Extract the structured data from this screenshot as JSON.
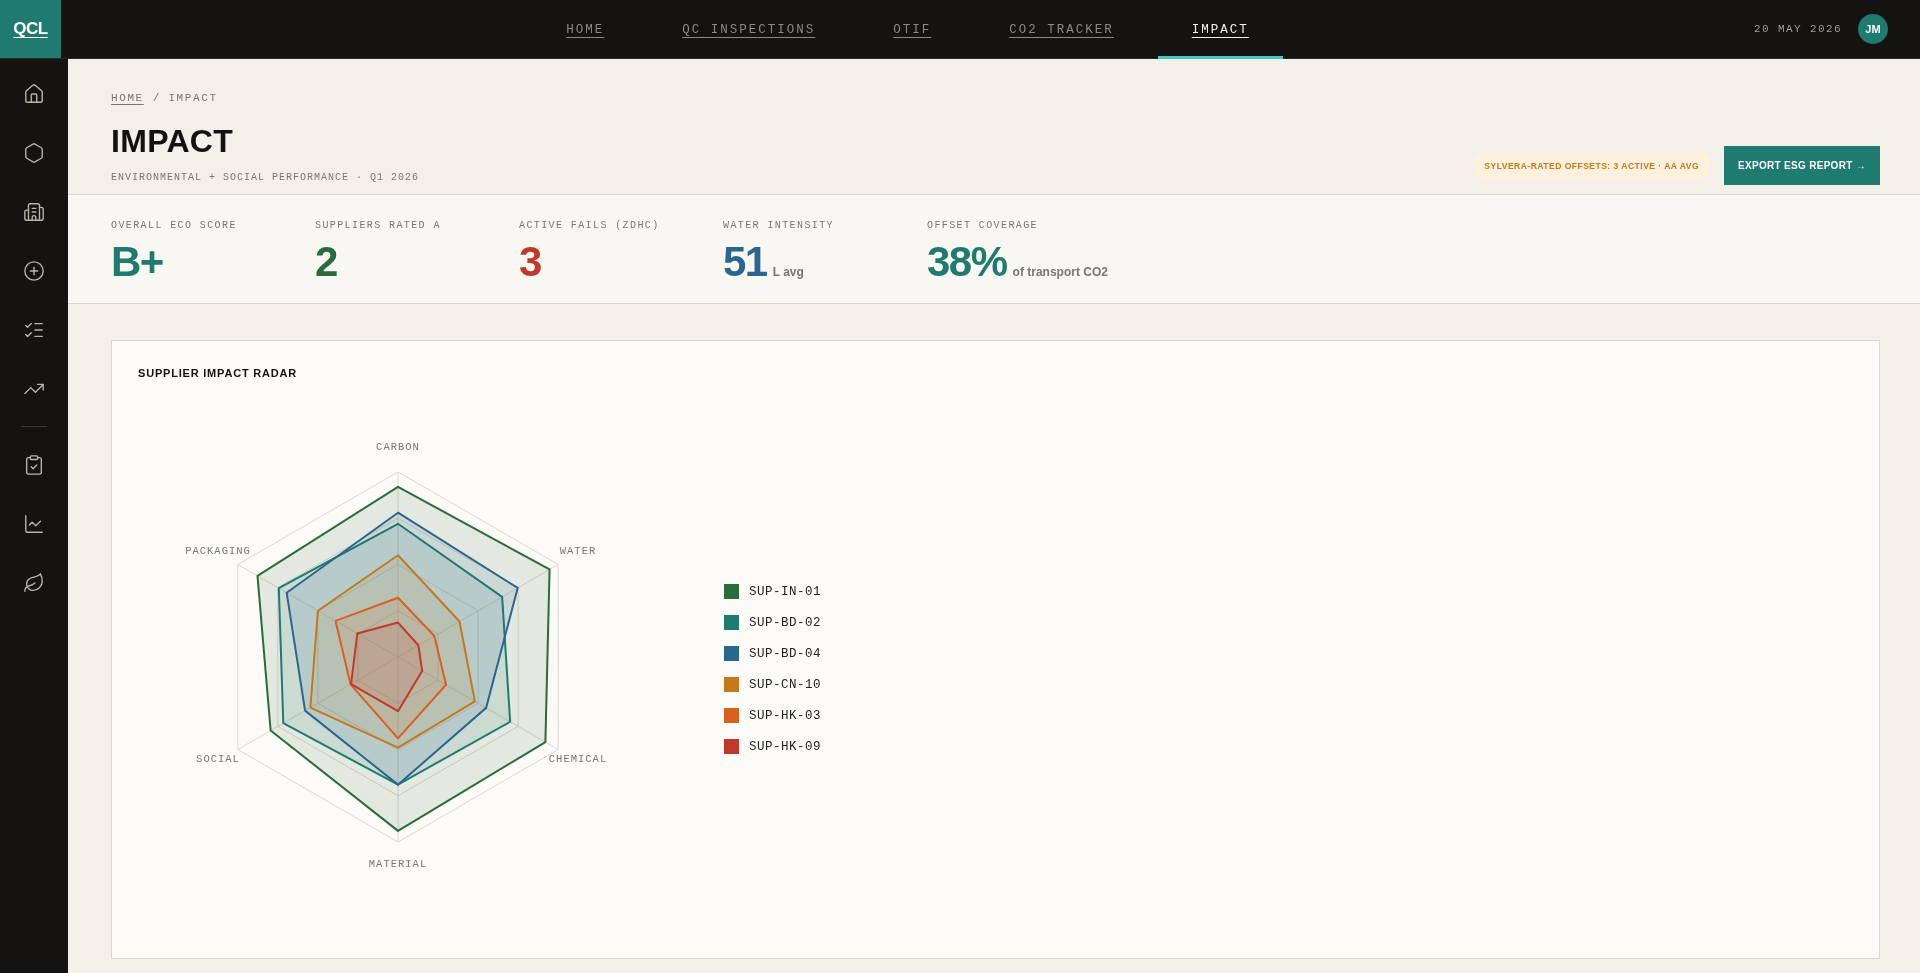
{
  "top_bar": {
    "logo": "QCL",
    "nav": [
      {
        "label": "HOME",
        "selected": false
      },
      {
        "label": "QC INSPECTIONS",
        "selected": false
      },
      {
        "label": "OTIF",
        "selected": false
      },
      {
        "label": "CO2 TRACKER",
        "selected": false
      },
      {
        "label": "IMPACT",
        "selected": true
      }
    ],
    "date": "20 MAY 2026",
    "avatar": "JM"
  },
  "breadcrumb": [
    {
      "label": "HOME",
      "kind": "link"
    },
    {
      "label": "/",
      "kind": "separator"
    },
    {
      "label": "IMPACT",
      "kind": "current"
    }
  ],
  "header": {
    "title": "IMPACT",
    "subtitle": "ENVIRONMENTAL + SOCIAL PERFORMANCE · Q1 2026",
    "badge": "SYLVERA-RATED OFFSETS: 3 ACTIVE · AA AVG",
    "export_button": "EXPORT ESG REPORT →"
  },
  "kpis": [
    {
      "label": "OVERALL ECO SCORE",
      "value": "B+",
      "color": "#1f7a70"
    },
    {
      "label": "SUPPLIERS RATED A",
      "value": "2",
      "color": "#2a6b3d"
    },
    {
      "label": "ACTIVE FAILS (ZDHC)",
      "value": "3",
      "color": "#c0392b"
    },
    {
      "label": "WATER INTENSITY",
      "value": "51",
      "unit": "L avg",
      "color": "#2b6690"
    },
    {
      "label": "OFFSET COVERAGE",
      "value": "38%",
      "unit": "of transport CO2",
      "color": "#1f7a70"
    }
  ],
  "radar": {
    "title": "SUPPLIER IMPACT RADAR",
    "axes": [
      "CARBON",
      "WATER",
      "CHEMICAL",
      "MATERIAL",
      "SOCIAL",
      "PACKAGING"
    ],
    "legend": [
      {
        "label": "SUP-IN-01",
        "color": "#2a6b3d"
      },
      {
        "label": "SUP-BD-02",
        "color": "#1f7a70"
      },
      {
        "label": "SUP-BD-04",
        "color": "#2b6690"
      },
      {
        "label": "SUP-CN-10",
        "color": "#c47a1c"
      },
      {
        "label": "SUP-HK-03",
        "color": "#d9601e"
      },
      {
        "label": "SUP-HK-09",
        "color": "#c0392b"
      }
    ]
  }
}
